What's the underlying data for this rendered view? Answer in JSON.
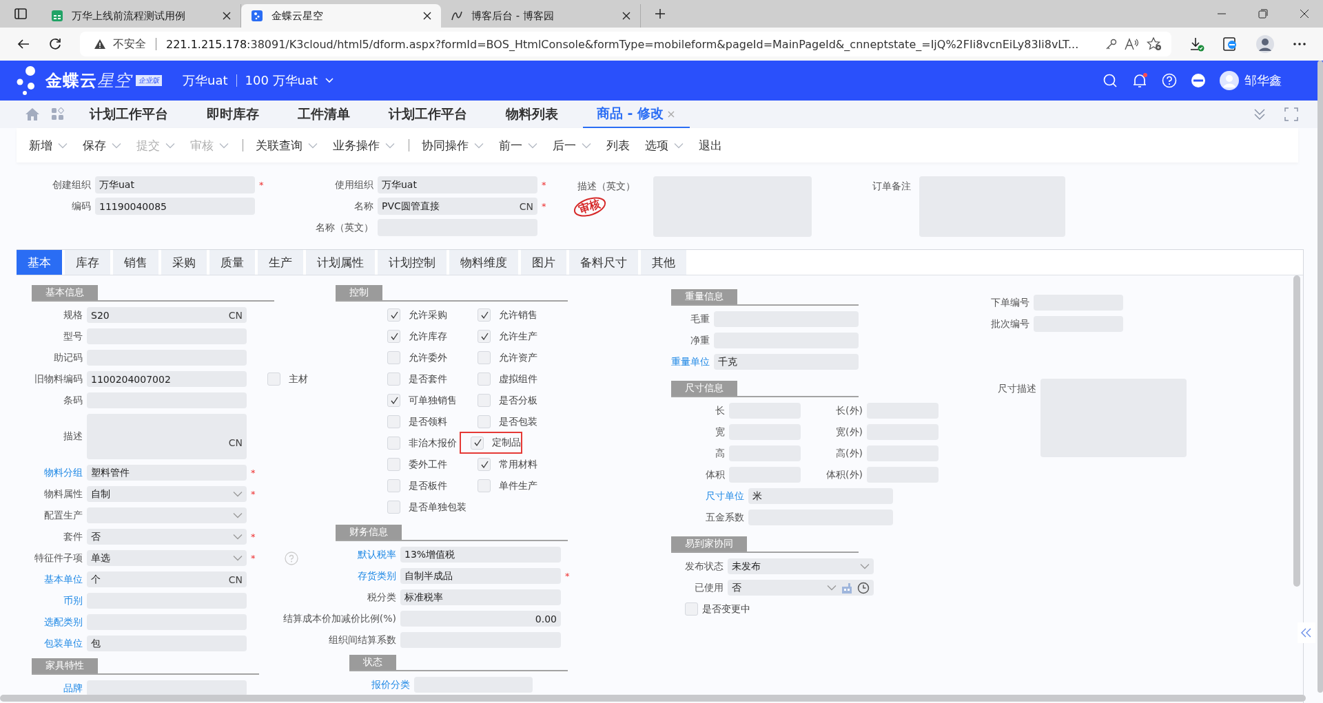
{
  "browser": {
    "tabs": [
      {
        "title": "万华上线前流程测试用例",
        "selected": false
      },
      {
        "title": "金蝶云星空",
        "selected": true
      },
      {
        "title": "博客后台 - 博客园",
        "selected": false
      }
    ],
    "address": {
      "warning": "不安全",
      "host": "221.1.215.178",
      "path": ":38091/K3cloud/html5/dform.aspx?formId=BOS_HtmlConsole&formType=mobileform&pageId=MainPageId&_cnneptstate_=IjQ%2FIi8vcnEiLy83Ii8vLT..."
    }
  },
  "app": {
    "logo": "金蝶云",
    "logo_accent": "星空",
    "edition": "企业版",
    "org": "万华uat",
    "account": "100 万华uat",
    "user": "邹华鑫",
    "notification": true
  },
  "nav_tabs": [
    {
      "label": "计划工作平台",
      "selected": false
    },
    {
      "label": "即时库存",
      "selected": false
    },
    {
      "label": "工件清单",
      "selected": false
    },
    {
      "label": "计划工作平台",
      "selected": false
    },
    {
      "label": "物料列表",
      "selected": false
    },
    {
      "label": "商品 - 修改",
      "selected": true,
      "close": "×"
    }
  ],
  "toolbar_groups": [
    [
      {
        "label": "新增",
        "disabled": false,
        "dropdown": true
      },
      {
        "label": "保存",
        "disabled": false,
        "dropdown": true
      },
      {
        "label": "提交",
        "disabled": true,
        "dropdown": true
      },
      {
        "label": "审核",
        "disabled": true,
        "dropdown": true
      }
    ],
    [
      {
        "label": "关联查询",
        "disabled": false,
        "dropdown": true
      },
      {
        "label": "业务操作",
        "disabled": false,
        "dropdown": true
      }
    ],
    [
      {
        "label": "协同操作",
        "disabled": false,
        "dropdown": true
      },
      {
        "label": "前一",
        "disabled": false,
        "dropdown": true
      },
      {
        "label": "后一",
        "disabled": false,
        "dropdown": true
      },
      {
        "label": "列表",
        "disabled": false,
        "dropdown": false
      },
      {
        "label": "选项",
        "disabled": false,
        "dropdown": true
      },
      {
        "label": "退出",
        "disabled": false,
        "dropdown": false
      }
    ]
  ],
  "header_columns": [
    [
      {
        "kind": "text",
        "label": "创建组织",
        "value": "万华uat",
        "required_mark": "*"
      },
      {
        "kind": "text",
        "label": "编码",
        "value": "11190040085"
      }
    ],
    [
      {
        "kind": "text",
        "label": "使用组织",
        "value": "万华uat",
        "required_mark": "*"
      },
      {
        "kind": "text",
        "label": "名称",
        "value": "PVC圆管直接",
        "suffix": "CN",
        "required_mark": "*"
      },
      {
        "kind": "text",
        "label": "名称（英文）"
      }
    ],
    [
      {
        "kind": "textarea",
        "label": "描述（英文）"
      }
    ],
    [
      {
        "kind": "textarea",
        "label": "订单备注"
      }
    ]
  ],
  "stamp": "审核",
  "form_tabs": [
    {
      "label": "基本",
      "selected": true
    },
    {
      "label": "库存",
      "selected": false
    },
    {
      "label": "销售",
      "selected": false
    },
    {
      "label": "采购",
      "selected": false
    },
    {
      "label": "质量",
      "selected": false
    },
    {
      "label": "生产",
      "selected": false
    },
    {
      "label": "计划属性",
      "selected": false
    },
    {
      "label": "计划控制",
      "selected": false
    },
    {
      "label": "物料维度",
      "selected": false
    },
    {
      "label": "图片",
      "selected": false
    },
    {
      "label": "备料尺寸",
      "selected": false
    },
    {
      "label": "其他",
      "selected": false
    }
  ],
  "panel_columns": [
    [
      {
        "title": "基本信息",
        "rows": [
          {
            "kind": "text",
            "label": "规格",
            "value": "S20",
            "suffix": "CN"
          },
          {
            "kind": "text",
            "label": "型号"
          },
          {
            "kind": "text",
            "label": "助记码"
          },
          {
            "kind": "text",
            "label": "旧物料编码",
            "value": "1100204007002",
            "checkbox": {
              "label": "主材",
              "checked": false
            }
          },
          {
            "kind": "text",
            "label": "条码"
          },
          {
            "kind": "textarea",
            "label": "描述",
            "suffix": "CN"
          },
          {
            "kind": "text",
            "label": "物料分组",
            "link": true,
            "value": "塑料管件",
            "required_mark": "*"
          },
          {
            "kind": "select",
            "label": "物料属性",
            "value": "自制",
            "required_mark": "*"
          },
          {
            "kind": "select",
            "label": "配置生产"
          },
          {
            "kind": "select",
            "label": "套件",
            "value": "否",
            "required_mark": "*"
          },
          {
            "kind": "select",
            "label": "特征件子项",
            "value": "单选",
            "required_mark": "*",
            "help": true
          },
          {
            "kind": "text",
            "label": "基本单位",
            "link": true,
            "value": "个",
            "suffix": "CN"
          },
          {
            "kind": "text",
            "label": "币别",
            "link": true
          },
          {
            "kind": "text",
            "label": "选配类别",
            "link": true
          },
          {
            "kind": "text",
            "label": "包装单位",
            "link": true,
            "value": "包"
          }
        ]
      },
      {
        "title": "家具特性",
        "rows": [
          {
            "kind": "text",
            "label": "品牌",
            "link": true
          }
        ]
      }
    ],
    [
      {
        "title": "控制",
        "rows": [
          {
            "kind": "check_pair",
            "items": [
              {
                "label": "允许采购",
                "checked": true,
                "highlighted": false
              },
              {
                "label": "允许销售",
                "checked": true,
                "highlighted": false
              }
            ]
          },
          {
            "kind": "check_pair",
            "items": [
              {
                "label": "允许库存",
                "checked": true,
                "highlighted": false
              },
              {
                "label": "允许生产",
                "checked": true,
                "highlighted": false
              }
            ]
          },
          {
            "kind": "check_pair",
            "items": [
              {
                "label": "允许委外",
                "checked": false,
                "highlighted": false
              },
              {
                "label": "允许资产",
                "checked": false,
                "highlighted": false
              }
            ]
          },
          {
            "kind": "check_pair",
            "items": [
              {
                "label": "是否套件",
                "checked": false,
                "highlighted": false
              },
              {
                "label": "虚拟组件",
                "checked": false,
                "highlighted": false
              }
            ]
          },
          {
            "kind": "check_pair",
            "items": [
              {
                "label": "可单独销售",
                "checked": true,
                "highlighted": false
              },
              {
                "label": "是否分板",
                "checked": false,
                "highlighted": false
              }
            ]
          },
          {
            "kind": "check_pair",
            "items": [
              {
                "label": "是否领料",
                "checked": false,
                "highlighted": false
              },
              {
                "label": "是否包装",
                "checked": false,
                "highlighted": false
              }
            ]
          },
          {
            "kind": "check_pair",
            "items": [
              {
                "label": "非治木报价",
                "checked": false,
                "highlighted": false
              },
              {
                "label": "定制品",
                "checked": true,
                "highlighted": true
              }
            ]
          },
          {
            "kind": "check_pair",
            "items": [
              {
                "label": "委外工件",
                "checked": false,
                "highlighted": false
              },
              {
                "label": "常用材料",
                "checked": true,
                "highlighted": false
              }
            ]
          },
          {
            "kind": "check_pair",
            "items": [
              {
                "label": "是否板件",
                "checked": false,
                "highlighted": false
              },
              {
                "label": "单件生产",
                "checked": false,
                "highlighted": false
              }
            ]
          },
          {
            "kind": "check_pair",
            "items": [
              {
                "label": "是否单独包装",
                "checked": false,
                "highlighted": false
              }
            ]
          }
        ]
      },
      {
        "title": "财务信息",
        "rows": [
          {
            "kind": "text",
            "label": "默认税率",
            "link": true,
            "value": "13%增值税"
          },
          {
            "kind": "text",
            "label": "存货类别",
            "link": true,
            "value": "自制半成品",
            "required_mark": "*"
          },
          {
            "kind": "text",
            "label": "税分类",
            "value": "标准税率"
          },
          {
            "kind": "number",
            "label": "结算成本价加减价比例(%)",
            "value": "0.00"
          },
          {
            "kind": "text",
            "label": "组织间结算系数"
          }
        ]
      },
      {
        "title": "状态",
        "rows": [
          {
            "kind": "text",
            "label": "报价分类",
            "link": true
          }
        ]
      }
    ],
    [
      {
        "title": "重量信息",
        "rows": [
          {
            "kind": "text",
            "label": "毛重"
          },
          {
            "kind": "text",
            "label": "净重"
          },
          {
            "kind": "text",
            "label": "重量单位",
            "link": true,
            "value": "千克"
          }
        ]
      },
      {
        "title": "尺寸信息",
        "rows": [
          {
            "kind": "field_pair",
            "items": [
              {
                "label": "长"
              },
              {
                "label": "长(外)"
              }
            ]
          },
          {
            "kind": "field_pair",
            "items": [
              {
                "label": "宽"
              },
              {
                "label": "宽(外)"
              }
            ]
          },
          {
            "kind": "field_pair",
            "items": [
              {
                "label": "高"
              },
              {
                "label": "高(外)"
              }
            ]
          },
          {
            "kind": "field_pair",
            "items": [
              {
                "label": "体积"
              },
              {
                "label": "体积(外)"
              }
            ]
          },
          {
            "kind": "text",
            "label": "尺寸单位",
            "link": true,
            "value": "米"
          },
          {
            "kind": "text",
            "label": "五金系数"
          }
        ]
      },
      {
        "title": "易到家协同",
        "rows": [
          {
            "kind": "select",
            "label": "发布状态",
            "value": "未发布"
          },
          {
            "kind": "select",
            "label": "已使用",
            "value": "否",
            "date_icons": true
          },
          {
            "kind": "check_only",
            "label": "是否变更中",
            "checked": false
          }
        ]
      }
    ],
    [
      {
        "rows": [
          {
            "kind": "text",
            "label": "下单编号"
          },
          {
            "kind": "text",
            "label": "批次编号"
          },
          {
            "kind": "textarea",
            "label": "尺寸描述"
          }
        ]
      }
    ]
  ]
}
